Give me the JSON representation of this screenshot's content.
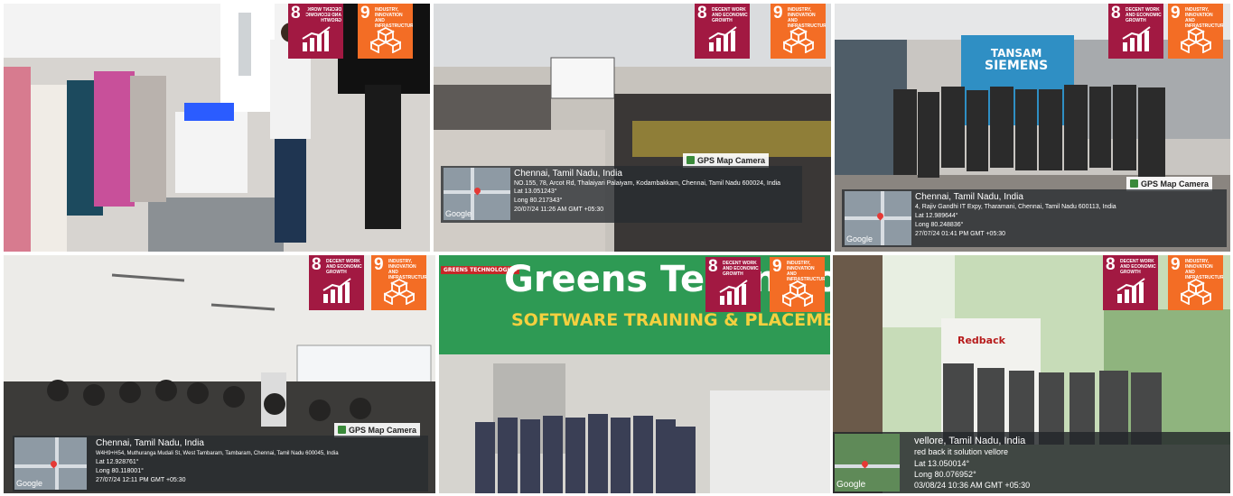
{
  "colors": {
    "sdg8": "#a21942",
    "sdg9": "#f36d25"
  },
  "sdg": {
    "goal8": {
      "number": "8",
      "label": "DECENT WORK AND ECONOMIC GROWTH",
      "mirrored_label": "DECENT WORK AND ECONOMIC GROWTH",
      "icon": "growth-chart-icon"
    },
    "goal9": {
      "number": "9",
      "label": "INDUSTRY, INNOVATION AND INFRASTRUCTURE",
      "icon": "cubes-icon"
    }
  },
  "photos": [
    {
      "id": "lab-visit",
      "description_key": "robotics-lab"
    },
    {
      "id": "seminar-hall",
      "gps_tag": "GPS Map Camera",
      "city": "Chennai, Tamil Nadu, India",
      "address": "NO.155, 78, Arcot Rd, Thalaiyari Palaiyam, Kodambakkam, Chennai, Tamil Nadu 600024, India",
      "lat": "Lat 13.051243°",
      "long": "Long 80.217343°",
      "time": "20/07/24 11:26 AM GMT +05:30",
      "google": "Google"
    },
    {
      "id": "tansam-siemens",
      "gps_tag": "GPS Map Camera",
      "sign_line1": "TANSAM",
      "sign_line2": "SIEMENS",
      "city": "Chennai, Tamil Nadu, India",
      "address": "4, Rajiv Gandhi IT Expy, Tharamani, Chennai, Tamil Nadu 600113, India",
      "lat": "Lat 12.989644°",
      "long": "Long 80.248836°",
      "time": "27/07/24 01:41 PM GMT +05:30",
      "google": "Google"
    },
    {
      "id": "classroom",
      "gps_tag": "GPS Map Camera",
      "city": "Chennai, Tamil Nadu, India",
      "address": "W4H9+H54, Muthuranga Mudali St, West Tambaram, Tambaram, Chennai, Tamil Nadu 600045, India",
      "lat": "Lat 12.928761°",
      "long": "Long 80.118001°",
      "time": "27/07/24 12:11 PM GMT +05:30",
      "google": "Google"
    },
    {
      "id": "greens-technologies",
      "sign_small": "GREENS TECHNOLOGIES",
      "sign_big": "Greens Technologies",
      "sign_sub": "SOFTWARE TRAINING & PLACEMENT"
    },
    {
      "id": "redback-solution",
      "sign": "Redback",
      "city": "vellore, Tamil Nadu, India",
      "address": "red back it solution vellore",
      "lat": "Lat 13.050014°",
      "long": "Long 80.076952°",
      "time": "03/08/24 10:36 AM GMT +05:30",
      "google": "Google"
    }
  ]
}
